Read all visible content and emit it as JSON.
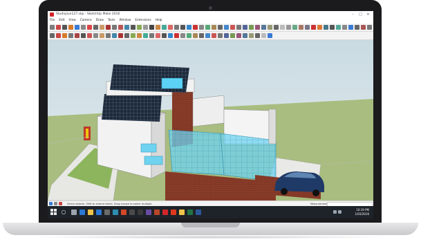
{
  "window": {
    "title": "Studiojiun127.skp - SketchUp Make 2016",
    "minimize": "–",
    "maximize": "□",
    "close": "✕"
  },
  "menu": [
    "File",
    "Edit",
    "View",
    "Camera",
    "Draw",
    "Tools",
    "Window",
    "Extensions",
    "Help"
  ],
  "status": {
    "message": "Select objects. Shift to extend select. Drag mouse to select multiple.",
    "measurements_label": "Measurements",
    "measurements_value": ""
  },
  "taskbar": {
    "search_glyph": "○",
    "time": "10:19 PM",
    "date": "1/03/2016"
  },
  "colors": {
    "brick": "#8a3d2a",
    "glass": "#6fd3f0",
    "ground": "#a8bd7f",
    "solar": "#1d2a3c",
    "car": "#1f3a66"
  },
  "icons": {
    "app_logo": "sketchup-logo-icon",
    "start": "windows-start-icon",
    "search": "search-icon"
  }
}
